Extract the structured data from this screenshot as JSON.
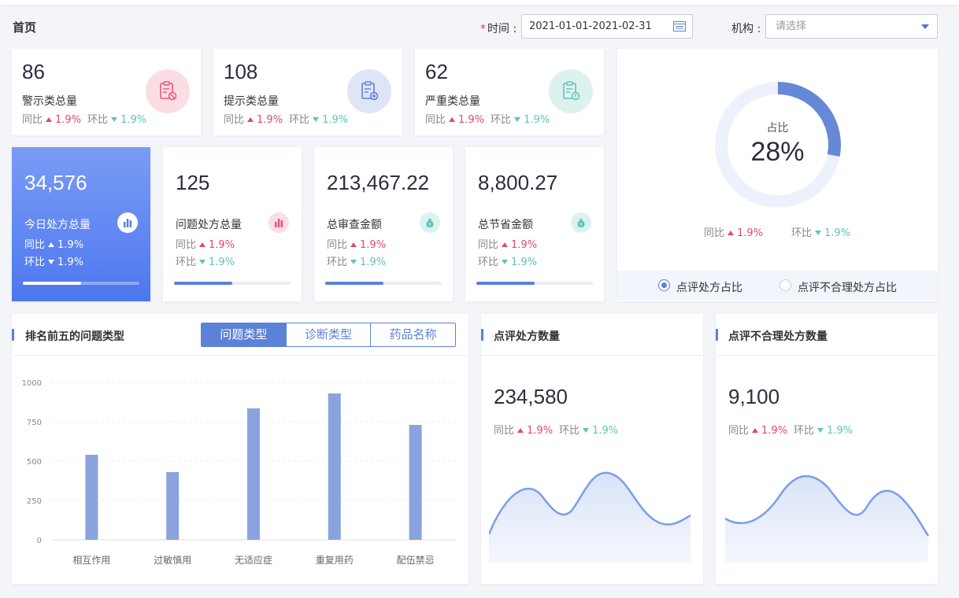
{
  "header": {
    "title": "首页",
    "time_label": "时间",
    "time_value": "2021-01-01-2021-02-31",
    "org_label": "机构",
    "org_placeholder": "请选择"
  },
  "trend": {
    "yoy": "同比",
    "mom": "环比",
    "yoy_value": "1.9%",
    "mom_value": "1.9%"
  },
  "top_cards": [
    {
      "value": "86",
      "label": "警示类总量",
      "icon": "clipboard-ban-icon",
      "color": "#e9567a"
    },
    {
      "value": "108",
      "label": "提示类总量",
      "icon": "clipboard-add-icon",
      "color": "#5b81d8"
    },
    {
      "value": "62",
      "label": "严重类总量",
      "icon": "clipboard-alert-icon",
      "color": "#5ec4b8"
    }
  ],
  "mid_cards": [
    {
      "value": "34,576",
      "label": "今日处方总量",
      "icon": "bar-chart-icon",
      "progress": 0.5
    },
    {
      "value": "125",
      "label": "问题处方总量",
      "icon": "bar-chart-icon",
      "progress": 0.5
    },
    {
      "value": "213,467.22",
      "label": "总审查金额",
      "icon": "money-bag-icon",
      "progress": 0.5
    },
    {
      "value": "8,800.27",
      "label": "总节省金额",
      "icon": "money-bag-icon",
      "progress": 0.5
    }
  ],
  "ratio": {
    "label": "占比",
    "value": "28%",
    "fraction": 0.28,
    "options": [
      "点评处方占比",
      "点评不合理处方占比"
    ],
    "selected": 0
  },
  "top5": {
    "title": "排名前五的问题类型",
    "tabs": [
      "问题类型",
      "诊断类型",
      "药品名称"
    ],
    "active_tab": 0
  },
  "chart_data": {
    "type": "bar",
    "categories": [
      "相互作用",
      "过敏慎用",
      "无适应症",
      "重复用药",
      "配伍禁忌"
    ],
    "values": [
      540,
      430,
      835,
      930,
      730
    ],
    "yticks": [
      0,
      250,
      500,
      750,
      1000
    ],
    "ylim": [
      0,
      1000
    ],
    "grid": true,
    "color": "#8aa3de"
  },
  "review_count": {
    "title": "点评处方数量",
    "value": "234,580"
  },
  "unreasonable_count": {
    "title": "点评不合理处方数量",
    "value": "9,100"
  }
}
